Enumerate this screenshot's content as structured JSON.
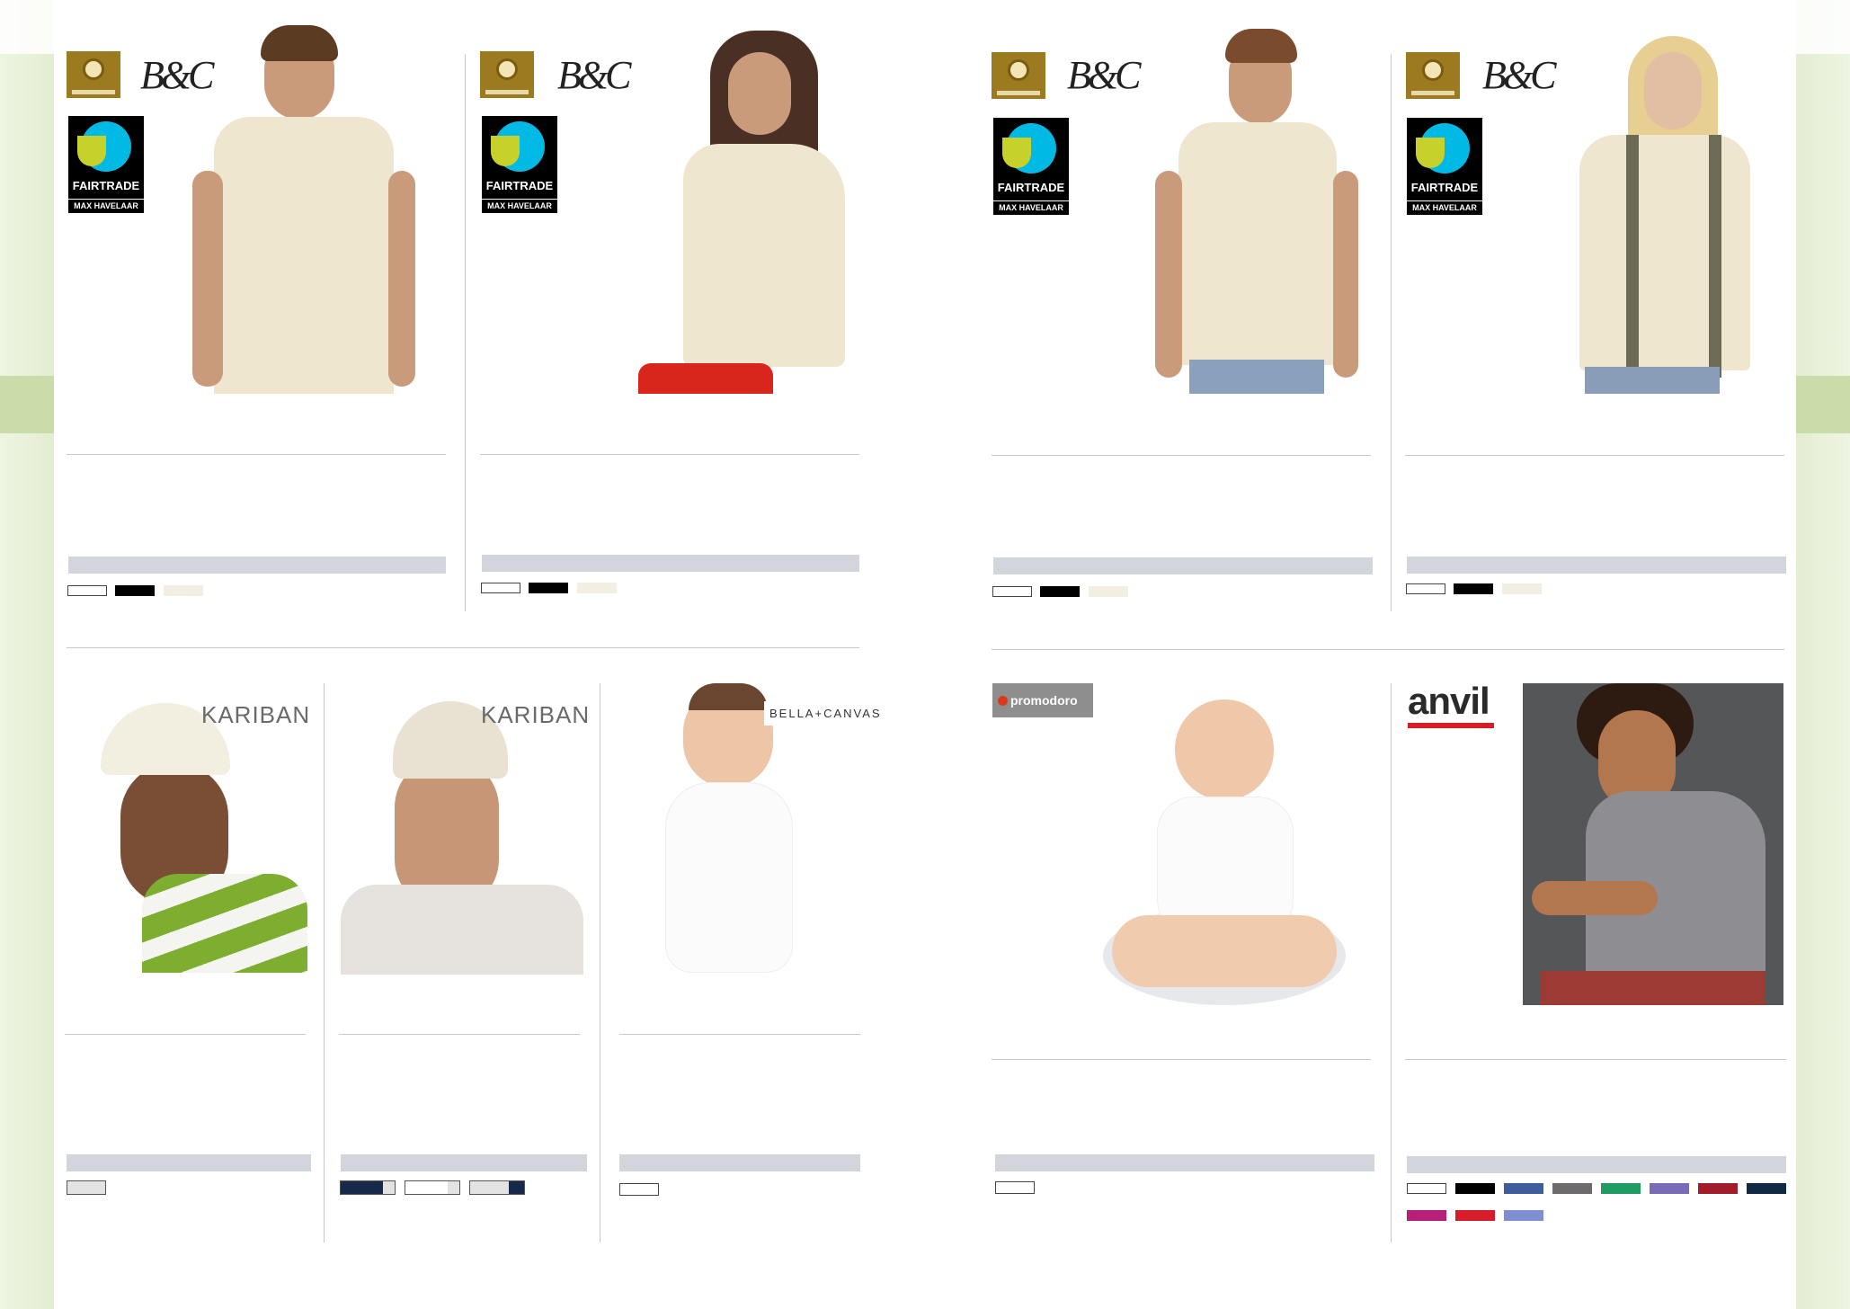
{
  "brands": {
    "bc": "B&C",
    "fairtrade_word": "FAIRTRADE",
    "fairtrade_sub": "MAX HAVELAAR",
    "kariban": "KARIBAN",
    "bella_canvas": "BELLA+CANVAS",
    "promodoro": "promodoro",
    "anvil": "anvil"
  },
  "colors": {
    "white": "#ffffff",
    "black": "#000000",
    "natural": "#f3eee2",
    "light_grey": "#e3e3e3",
    "navy": "#16294a",
    "anvil_palette": [
      "#ffffff",
      "#000000",
      "#3f5d9c",
      "#6e6a6e",
      "#1e9c63",
      "#7a6bb8",
      "#a21d2c",
      "#112a44",
      "#b81f78",
      "#d71d2c",
      "#7f8fd1"
    ]
  },
  "products": [
    {
      "id": "bc-polo-men",
      "brand": "B&C",
      "swatches": [
        "white",
        "black",
        "natural"
      ]
    },
    {
      "id": "bc-polo-women",
      "brand": "B&C",
      "swatches": [
        "white",
        "black",
        "natural"
      ]
    },
    {
      "id": "bc-tee-men",
      "brand": "B&C",
      "swatches": [
        "white",
        "black",
        "natural"
      ]
    },
    {
      "id": "bc-tee-women",
      "brand": "B&C",
      "swatches": [
        "white",
        "black",
        "natural"
      ]
    },
    {
      "id": "kariban-cap-1",
      "brand": "KARIBAN",
      "swatches": [
        "light_grey"
      ]
    },
    {
      "id": "kariban-cap-2",
      "brand": "KARIBAN",
      "swatches": [
        "navy/white",
        "white/light_grey",
        "light_grey/navy"
      ]
    },
    {
      "id": "bella-baby-body",
      "brand": "BELLA+CANVAS",
      "swatches": [
        "white"
      ]
    },
    {
      "id": "promodoro-baby-body",
      "brand": "promodoro",
      "swatches": [
        "white"
      ]
    },
    {
      "id": "anvil-tee",
      "brand": "anvil",
      "swatches": [
        "anvil_palette"
      ]
    }
  ]
}
